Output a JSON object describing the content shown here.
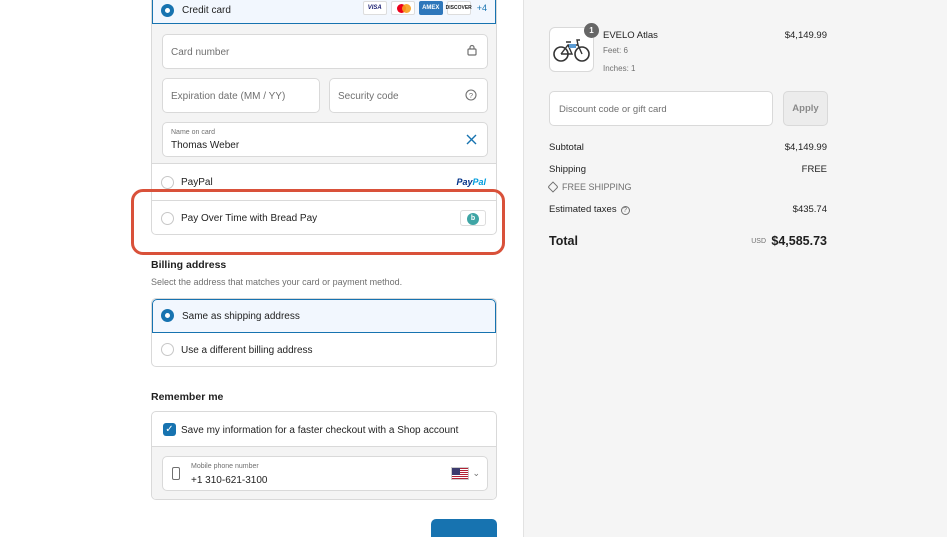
{
  "payment": {
    "credit_card_label": "Credit card",
    "card_brands": [
      "VISA",
      "AMEX",
      "DISCOVER"
    ],
    "more_cards": "+4",
    "card_number_placeholder": "Card number",
    "expiration_placeholder": "Expiration date (MM / YY)",
    "security_code_placeholder": "Security code",
    "name_on_card_label": "Name on card",
    "name_on_card_value": "Thomas Weber",
    "paypal_label": "PayPal",
    "paypal_logo_a": "Pay",
    "paypal_logo_b": "Pal",
    "bread_label": "Pay Over Time with Bread Pay",
    "bread_logo": "b"
  },
  "billing": {
    "title": "Billing address",
    "subtitle": "Select the address that matches your card or payment method.",
    "same_label": "Same as shipping address",
    "different_label": "Use a different billing address"
  },
  "remember": {
    "title": "Remember me",
    "save_label": "Save my information for a faster checkout with a Shop account",
    "phone_label": "Mobile phone number",
    "phone_value": "+1 310-621-3100"
  },
  "order": {
    "quantity": "1",
    "product_name": "EVELO Atlas",
    "variant_1": "Feet: 6",
    "variant_2": "Inches: 1",
    "product_price": "$4,149.99",
    "discount_placeholder": "Discount code or gift card",
    "apply_label": "Apply",
    "subtotal_label": "Subtotal",
    "subtotal_value": "$4,149.99",
    "shipping_label": "Shipping",
    "shipping_value": "FREE",
    "free_shipping_tag": "FREE SHIPPING",
    "taxes_label": "Estimated taxes",
    "taxes_value": "$435.74",
    "total_label": "Total",
    "currency": "USD",
    "total_value": "$4,585.73"
  },
  "colors": {
    "accent": "#1773b0",
    "highlight": "#d9513a",
    "panel": "#f5f5f5"
  }
}
